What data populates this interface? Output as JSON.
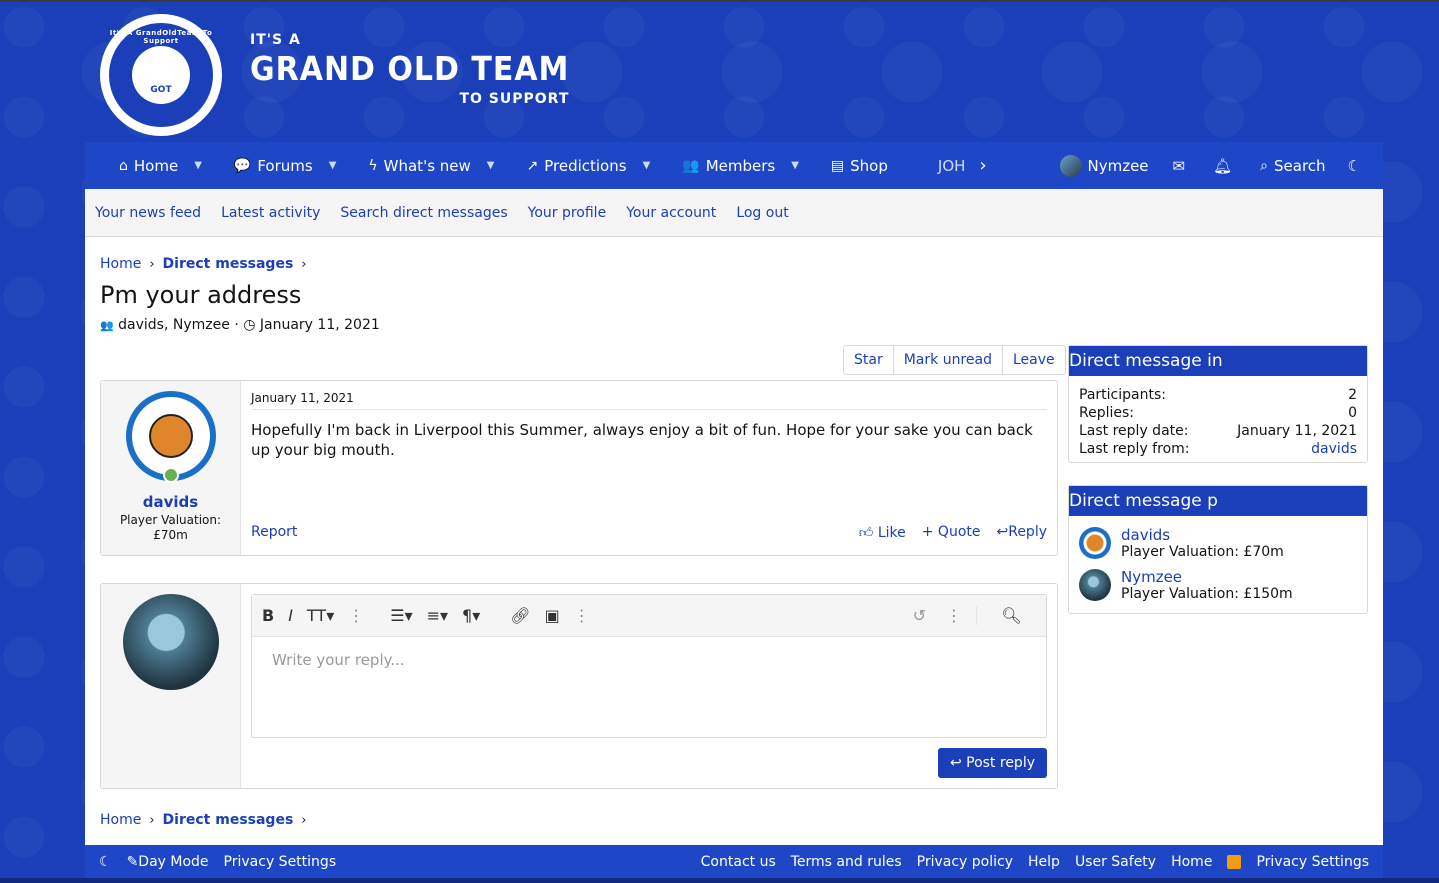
{
  "header": {
    "logo_ring_text": "It's A GrandOldTeam To Support",
    "logo_badge_text": "GOT",
    "title_small": "IT'S A",
    "title_big": "GRAND OLD TEAM",
    "title_sub": "TO SUPPORT"
  },
  "nav": {
    "items": [
      {
        "label": "Home",
        "icon": "home-icon"
      },
      {
        "label": "Forums",
        "icon": "chat-icon"
      },
      {
        "label": "What's new",
        "icon": "bolt-icon"
      },
      {
        "label": "Predictions",
        "icon": "chart-icon"
      },
      {
        "label": "Members",
        "icon": "users-icon"
      },
      {
        "label": "Shop",
        "icon": "shop-icon"
      },
      {
        "label": "JOH",
        "icon": ""
      }
    ],
    "user": "Nymzee",
    "search": "Search"
  },
  "subnav": [
    "Your news feed",
    "Latest activity",
    "Search direct messages",
    "Your profile",
    "Your account",
    "Log out"
  ],
  "breadcrumb": {
    "home": "Home",
    "section": "Direct messages"
  },
  "page": {
    "title": "Pm your address",
    "participants": "davids, Nymzee",
    "date": "January 11, 2021"
  },
  "actions": {
    "star": "Star",
    "mark_unread": "Mark unread",
    "leave": "Leave"
  },
  "message": {
    "author": "davids",
    "user_title": "Player Valuation: £70m",
    "date": "January 11, 2021",
    "text": "Hopefully I'm back in Liverpool this Summer, always enjoy a bit of fun. Hope for your sake you can back up your big mouth.",
    "report": "Report",
    "like": "Like",
    "quote": "Quote",
    "reply": "Reply"
  },
  "editor": {
    "placeholder": "Write your reply...",
    "post_reply": "Post reply"
  },
  "info_block": {
    "title": "Direct message in",
    "rows": [
      {
        "label": "Participants:",
        "value": "2"
      },
      {
        "label": "Replies:",
        "value": "0"
      },
      {
        "label": "Last reply date:",
        "value": "January 11, 2021"
      },
      {
        "label": "Last reply from:",
        "value": "davids"
      }
    ]
  },
  "participants_block": {
    "title": "Direct message p",
    "users": [
      {
        "name": "davids",
        "title": "Player Valuation: £70m"
      },
      {
        "name": "Nymzee",
        "title": "Player Valuation: £150m"
      }
    ]
  },
  "footer": {
    "day_mode": "Day Mode",
    "privacy_left": "Privacy Settings",
    "links": [
      "Contact us",
      "Terms and rules",
      "Privacy policy",
      "Help",
      "User Safety",
      "Home"
    ],
    "privacy_right": "Privacy Settings"
  },
  "colors": {
    "brand": "#1a3fb8",
    "nav": "#1e47c8",
    "online": "#63b34e"
  }
}
